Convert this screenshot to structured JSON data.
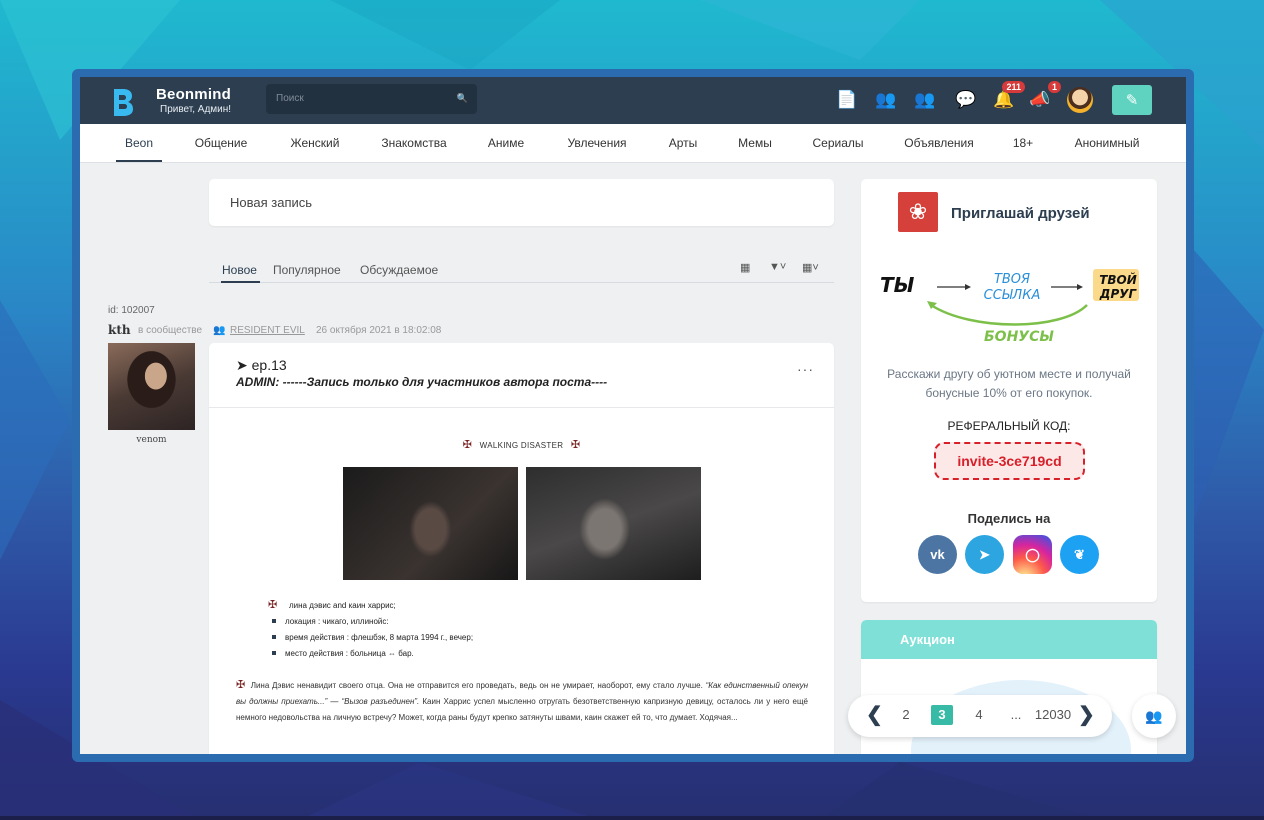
{
  "app": {
    "brand": "Beonmind",
    "greeting": "Привет, Админ!"
  },
  "search": {
    "placeholder": "Поиск"
  },
  "header": {
    "notifications_count": "211",
    "alerts_count": "1"
  },
  "nav": {
    "items": [
      "Beon",
      "Общение",
      "Женский",
      "Знакомства",
      "Аниме",
      "Увлечения",
      "Арты",
      "Мемы",
      "Сериалы",
      "Объявления",
      "18+",
      "Анонимный"
    ]
  },
  "composer": {
    "placeholder": "Новая запись"
  },
  "feed_tabs": [
    "Новое",
    "Популярное",
    "Обсуждаемое"
  ],
  "post": {
    "id_label": "id: 102007",
    "author": "kth",
    "in_community": "в сообществе",
    "community": "RESIDENT EVIL",
    "date": "26 октября 2021 в 18:02:08",
    "username": "venom",
    "title": "➤ ep.13",
    "subtitle": "ADMIN: ------Запись только для участников автора поста----",
    "heading": "WALKING DISASTER",
    "list": [
      "лина дэвис and каин харрис;",
      "локация : чикаго, иллинойс:",
      "время действия : флешбэк, 8 марта 1994 г., вечер;",
      "место действия : больница ⇔ бар."
    ],
    "body_start": "Лина Дэвис ненавидит своего отца. Она не отправится его проведать, ведь он не умирает, наоборот, ему стало лучше. ",
    "body_quote1": "“Как единственный опекун вы должны приехать...” — “Вызов разъединен”.",
    "body_rest": " Каин Харрис успел мысленно отругать безответственную капризную девицу, осталось ли у него ещё немного недовольства на личную встречу? Может, когда раны будут крепко затянуты швами, каин скажет ей то, что думает. Ходячая..."
  },
  "invite": {
    "title": "Приглашай друзей",
    "you": "ТЫ",
    "your_link": "ТВОЯ ССЫЛКА",
    "your_friend": "ТВОЙ ДРУГ",
    "bonuses": "БОНУСЫ",
    "description": "Расскажи другу об уютном месте и получай бонусные 10% от его покупок.",
    "ref_label": "РЕФЕРАЛЬНЫЙ КОД:",
    "ref_code": "invite-3ce719cd",
    "share_label": "Поделись на",
    "socials": [
      "vk-icon",
      "telegram-icon",
      "instagram-icon",
      "twitter-icon"
    ]
  },
  "auction": {
    "title": "Аукцион"
  },
  "pager": {
    "pages": [
      "2",
      "3",
      "4",
      "...",
      "12030"
    ],
    "current": "3"
  },
  "colors": {
    "header": "#2c3e50",
    "accent": "#5fd3bf",
    "active_page": "#38bba6",
    "ref_code": "#d8202a"
  }
}
